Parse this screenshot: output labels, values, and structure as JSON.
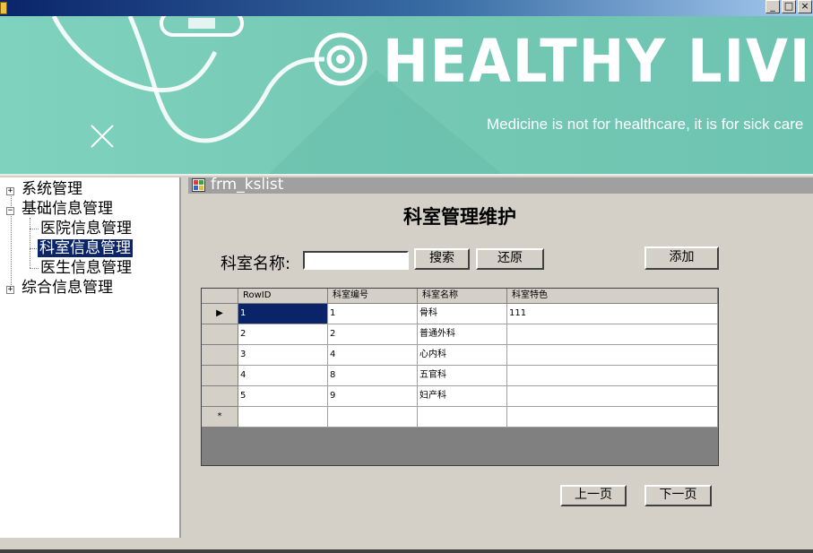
{
  "window": {
    "minimize_glyph": "_",
    "maximize_glyph": "□",
    "close_glyph": "×"
  },
  "banner": {
    "title": "HEALTHY LIVIN",
    "subtitle": "Medicine is not for healthcare, it is for sick care"
  },
  "tree": {
    "items": [
      {
        "label": "系统管理",
        "expander": "+"
      },
      {
        "label": "基础信息管理",
        "expander": "−"
      },
      {
        "label": "医院信息管理"
      },
      {
        "label": "科室信息管理",
        "selected": true
      },
      {
        "label": "医生信息管理"
      },
      {
        "label": "综合信息管理",
        "expander": "+"
      }
    ]
  },
  "child_window": {
    "title": "frm_kslist"
  },
  "form": {
    "heading": "科室管理维护",
    "search_label": "科室名称:",
    "search_value": "",
    "search_button": "搜索",
    "reset_button": "还原",
    "add_button": "添加",
    "prev_button": "上一页",
    "next_button": "下一页"
  },
  "grid": {
    "columns": [
      "RowID",
      "科室编号",
      "科室名称",
      "科室特色"
    ],
    "rows": [
      [
        "1",
        "1",
        "骨科",
        "111"
      ],
      [
        "2",
        "2",
        "普通外科",
        ""
      ],
      [
        "3",
        "4",
        "心内科",
        ""
      ],
      [
        "4",
        "8",
        "五官科",
        ""
      ],
      [
        "5",
        "9",
        "妇产科",
        ""
      ]
    ],
    "current_row_marker": "▶",
    "new_row_marker": "*"
  },
  "colors": {
    "banner_teal": "#75c9b5",
    "selection": "#0a246a",
    "window_face": "#d4d0c8"
  }
}
